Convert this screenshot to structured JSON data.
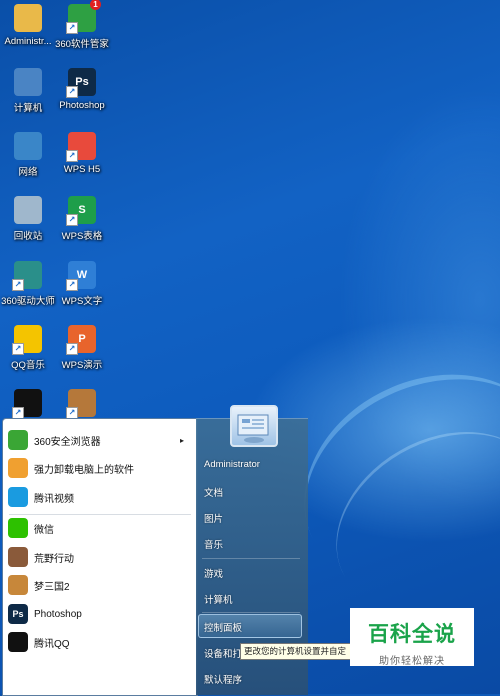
{
  "desktop": {
    "icons": [
      {
        "label": "Administr...",
        "icon": "folder-icon",
        "color": "#e9b949"
      },
      {
        "label": "360软件管家",
        "icon": "360-software-manager-icon",
        "color": "#2ea043",
        "badge": "1"
      },
      {
        "label": "计算机",
        "icon": "computer-icon",
        "color": "#4a84c4"
      },
      {
        "label": "Photoshop",
        "icon": "photoshop-icon",
        "color": "#0e2a47",
        "text": "Ps"
      },
      {
        "label": "网络",
        "icon": "network-icon",
        "color": "#3a86c8"
      },
      {
        "label": "WPS H5",
        "icon": "wps-h5-icon",
        "color": "#e84a3c"
      },
      {
        "label": "回收站",
        "icon": "recycle-bin-icon",
        "color": "#9fb7cc"
      },
      {
        "label": "WPS表格",
        "icon": "wps-spreadsheet-icon",
        "color": "#1e9e4a",
        "text": "S"
      },
      {
        "label": "360驱动大师",
        "icon": "360-driver-icon",
        "color": "#2a8f8a"
      },
      {
        "label": "WPS文字",
        "icon": "wps-writer-icon",
        "color": "#2f7fd6",
        "text": "W"
      },
      {
        "label": "QQ音乐",
        "icon": "qq-music-icon",
        "color": "#f4c400"
      },
      {
        "label": "WPS演示",
        "icon": "wps-presentation-icon",
        "color": "#e8642c",
        "text": "P"
      },
      {
        "label": "",
        "icon": "qq-penguin-icon",
        "color": "#111111"
      },
      {
        "label": "",
        "icon": "game-icon",
        "color": "#b5783a"
      }
    ]
  },
  "start_menu": {
    "programs": [
      {
        "label": "360安全浏览器",
        "icon": "360-browser-icon",
        "color": "#3aa635",
        "has_submenu": true
      },
      {
        "label": "强力卸载电脑上的软件",
        "icon": "uninstaller-icon",
        "color": "#f0a030"
      },
      {
        "label": "腾讯视频",
        "icon": "tencent-video-icon",
        "color": "#1a9be0"
      },
      {
        "label": "微信",
        "icon": "wechat-icon",
        "color": "#2dc100"
      },
      {
        "label": "荒野行动",
        "icon": "knives-out-game-icon",
        "color": "#8a5a3a"
      },
      {
        "label": "梦三国2",
        "icon": "meng-san-guo-icon",
        "color": "#c7873a"
      },
      {
        "label": "Photoshop",
        "icon": "photoshop-icon",
        "color": "#0e2a47",
        "text": "Ps"
      },
      {
        "label": "腾讯QQ",
        "icon": "qq-penguin-icon",
        "color": "#111111"
      }
    ],
    "submenu_arrow": "▸",
    "right_pane": {
      "user": "Administrator",
      "items": [
        "文档",
        "图片",
        "音乐",
        "游戏",
        "计算机",
        "控制面板",
        "设备和打",
        "默认程序"
      ],
      "highlighted": "控制面板"
    },
    "tooltip": "更改您的计算机设置并自定"
  },
  "watermark": {
    "title": "百科全说",
    "subtitle": "助你轻松解决"
  }
}
